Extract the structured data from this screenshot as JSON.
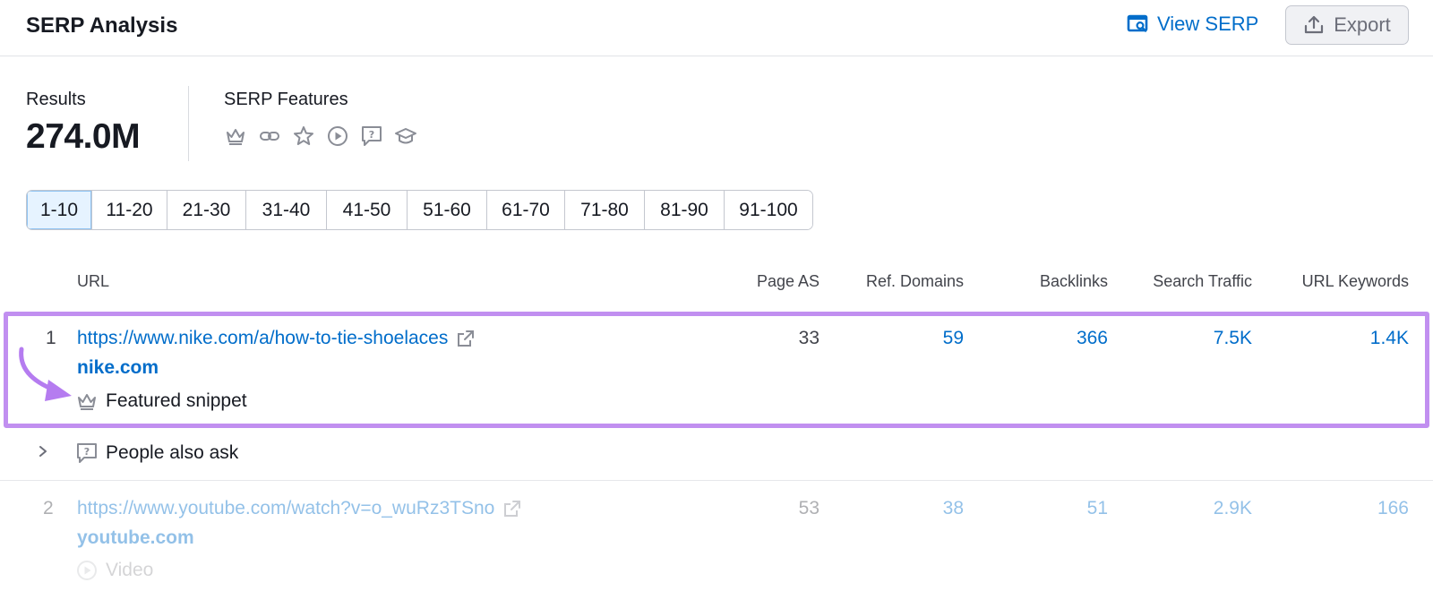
{
  "header": {
    "title": "SERP Analysis",
    "view_serp_label": "View SERP",
    "export_label": "Export"
  },
  "summary": {
    "results_label": "Results",
    "results_value": "274.0M",
    "features_label": "SERP Features",
    "feature_icons": [
      "crown-icon",
      "link-icon",
      "star-icon",
      "play-circle-icon",
      "question-bubble-icon",
      "graduation-cap-icon"
    ]
  },
  "pagination": {
    "pages": [
      "1-10",
      "11-20",
      "21-30",
      "31-40",
      "41-50",
      "51-60",
      "61-70",
      "71-80",
      "81-90",
      "91-100"
    ],
    "active": "1-10"
  },
  "table": {
    "columns": {
      "url": "URL",
      "page_as": "Page AS",
      "ref_domains": "Ref. Domains",
      "backlinks": "Backlinks",
      "search_traffic": "Search Traffic",
      "url_keywords": "URL Keywords"
    },
    "rows": [
      {
        "position": "1",
        "url": "https://www.nike.com/a/how-to-tie-shoelaces",
        "domain": "nike.com",
        "feature": "Featured snippet",
        "page_as": "33",
        "ref_domains": "59",
        "backlinks": "366",
        "search_traffic": "7.5K",
        "url_keywords": "1.4K"
      },
      {
        "position": "2",
        "url": "https://www.youtube.com/watch?v=o_wuRz3TSno",
        "domain": "youtube.com",
        "feature": "Video",
        "page_as": "53",
        "ref_domains": "38",
        "backlinks": "51",
        "search_traffic": "2.9K",
        "url_keywords": "166"
      }
    ],
    "people_also_ask": "People also ask"
  },
  "colors": {
    "link": "#006dca",
    "highlight": "#c18ff0",
    "arrow": "#b57cf0"
  }
}
